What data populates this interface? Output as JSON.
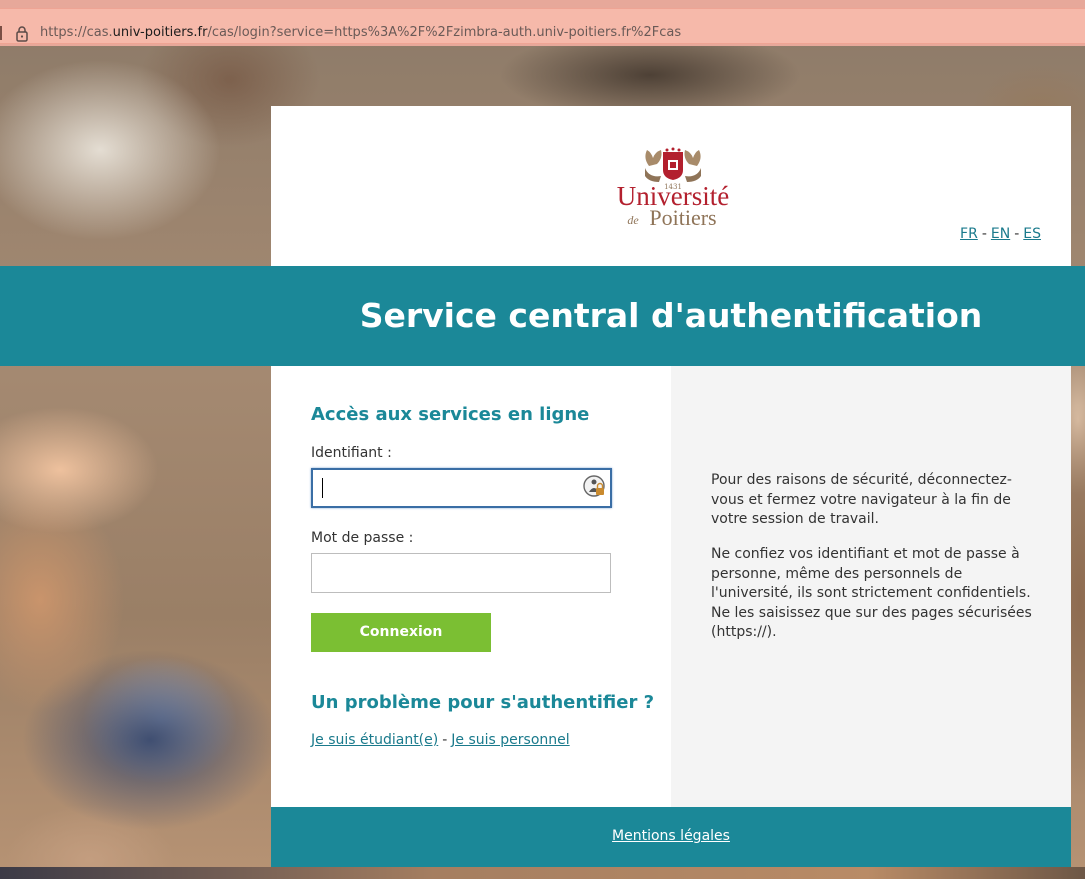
{
  "browser": {
    "url_prefix": "https://cas.",
    "url_domain": "univ-poitiers.fr",
    "url_rest": "/cas/login?service=https%3A%2F%2Fzimbra-auth.univ-poitiers.fr%2Fcas"
  },
  "header": {
    "logo_year": "1431",
    "logo_line1": "Université",
    "logo_line2_de": "de",
    "logo_line2": "Poitiers",
    "languages": [
      "FR",
      "EN",
      "ES"
    ],
    "lang_separator": "-"
  },
  "band": {
    "title": "Service central d'authentification"
  },
  "login": {
    "section_title": "Accès aux services en ligne",
    "username_label": "Identifiant :",
    "username_value": "",
    "password_label": "Mot de passe :",
    "password_value": "",
    "submit_label": "Connexion"
  },
  "help": {
    "title": "Un problème pour s'authentifier ?",
    "student_link": "Je suis étudiant(e)",
    "separator": "-",
    "staff_link": "Je suis personnel"
  },
  "info": {
    "paragraph1": "Pour des raisons de sécurité, déconnectez-vous et fermez votre navigateur à la fin de votre session de travail.",
    "paragraph2": "Ne confiez vos identifiant et mot de passe à personne, même des personnels de l'université, ils sont strictement confidentiels. Ne les saisissez que sur des pages sécurisées (https://)."
  },
  "footer": {
    "legal_link": "Mentions légales"
  },
  "colors": {
    "teal": "#1b8898",
    "button_green": "#7bbf33",
    "logo_red": "#b3202e",
    "right_panel": "#f4f4f4"
  },
  "icons": {
    "lock": "lock-icon",
    "password_manager": "password-manager-icon"
  }
}
